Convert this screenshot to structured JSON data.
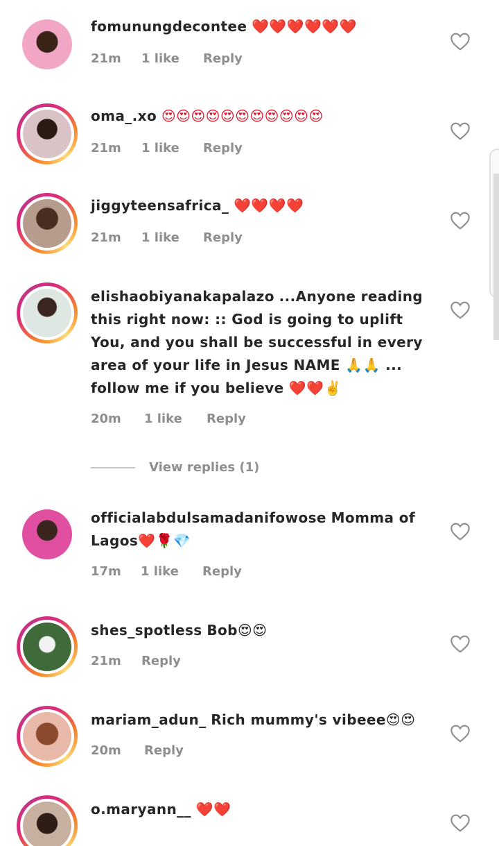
{
  "comments": [
    {
      "username": "fomunungdecontee",
      "text": "",
      "emojis": "❤️❤️❤️❤️❤️❤️",
      "time": "21m",
      "likes": "1 like",
      "reply": "Reply"
    },
    {
      "username": "oma_.xo",
      "text": "",
      "emojis": "😍😍😍😍😍😍😍😍😍😍😍",
      "time": "21m",
      "likes": "1 like",
      "reply": "Reply"
    },
    {
      "username": "jiggyteensafrica_",
      "text": "",
      "emojis": "❤️❤️❤️❤️",
      "time": "21m",
      "likes": "1 like",
      "reply": "Reply"
    },
    {
      "username": "elishaobiyanakapalazo",
      "text": "...Anyone reading this right now: :: God is going to uplift You, and you shall be successful in every area of your life in Jesus NAME 🙏🙏 ... follow me if you believe ❤️❤️✌️",
      "emojis": "",
      "time": "20m",
      "likes": "1 like",
      "reply": "Reply"
    },
    {
      "username": "officialabdulsamadanifowose",
      "text": "Momma of Lagos❤️🌹💎",
      "emojis": "",
      "time": "17m",
      "likes": "1 like",
      "reply": "Reply"
    },
    {
      "username": "shes_spotless",
      "text": "Bob😍😍",
      "emojis": "",
      "time": "21m",
      "likes": "",
      "reply": "Reply"
    },
    {
      "username": "mariam_adun_",
      "text": "Rich mummy's vibeee😍😍",
      "emojis": "",
      "time": "20m",
      "likes": "",
      "reply": "Reply"
    },
    {
      "username": "o.maryann__",
      "text": "",
      "emojis": "❤️❤️",
      "time": "",
      "likes": "",
      "reply": ""
    }
  ],
  "view_replies": "View replies (1)",
  "icons": {
    "like": "heart-outline-icon"
  },
  "colors": {
    "text": "#262626",
    "meta": "#8e8e8e",
    "story_ring_start": "#f58529",
    "story_ring_end": "#dd2a7b"
  }
}
